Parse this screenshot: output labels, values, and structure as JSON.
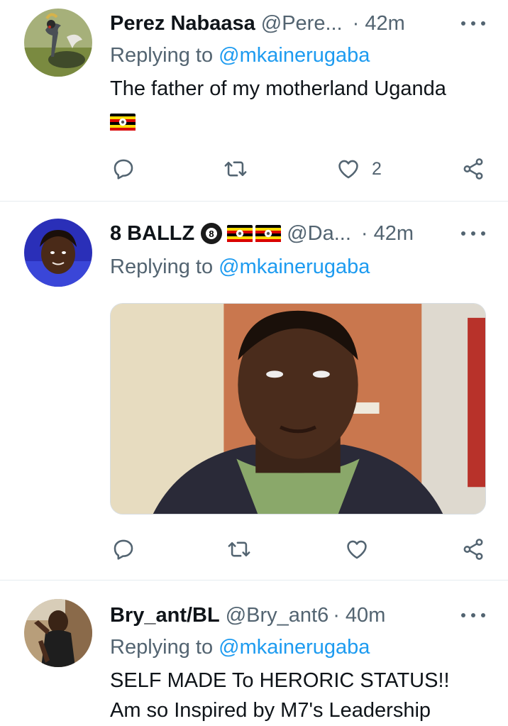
{
  "colors": {
    "text": "#0f1419",
    "secondary": "#536471",
    "link": "#1d9bf0",
    "divider": "#e6ecf0"
  },
  "tweets": [
    {
      "name": "Perez Nabaasa",
      "handle": "@Pere...",
      "time": "· 42m",
      "reply_prefix": "Replying to ",
      "reply_to": "@mkainerugaba",
      "text_line1": "The father of my motherland Uganda",
      "emoji": "uganda-flag",
      "likes": "2",
      "avatar": "crowned-crane-photo"
    },
    {
      "name": "8 BALLZ",
      "badges": [
        "8-ball-emoji",
        "uganda-flag",
        "uganda-flag"
      ],
      "handle": "@Da...",
      "time": "· 42m",
      "reply_prefix": "Replying to ",
      "reply_to": "@mkainerugaba",
      "media": "photo-of-young-man",
      "avatar": "selfie-photo"
    },
    {
      "name": "Bry_ant/BL",
      "handle": "@Bry_ant6",
      "time": "· 40m",
      "reply_prefix": "Replying to ",
      "reply_to": "@mkainerugaba",
      "text_line1": "SELF MADE To HERORIC STATUS!!",
      "text_line2": "Am so Inspired by M7's Leadership",
      "avatar": "person-photo"
    }
  ],
  "icons": {
    "reply": "reply-icon",
    "retweet": "retweet-icon",
    "like": "heart-icon",
    "share": "share-icon",
    "more": "more-icon"
  }
}
